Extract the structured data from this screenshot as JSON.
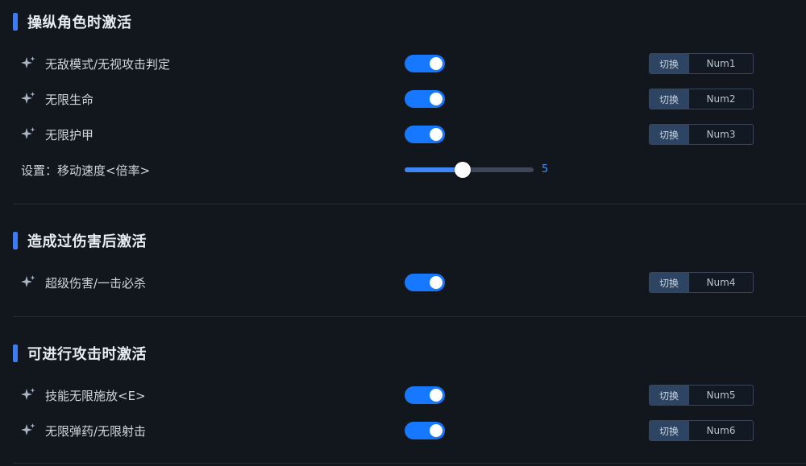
{
  "sections": [
    {
      "title": "操纵角色时激活",
      "items": [
        {
          "label": "无敌模式/无视攻击判定",
          "enabled": true,
          "hotkey_button": "切换",
          "hotkey": "Num1",
          "icon": "sparkle-icon"
        },
        {
          "label": "无限生命",
          "enabled": true,
          "hotkey_button": "切换",
          "hotkey": "Num2",
          "icon": "sparkle-icon"
        },
        {
          "label": "无限护甲",
          "enabled": true,
          "hotkey_button": "切换",
          "hotkey": "Num3",
          "icon": "sparkle-icon"
        }
      ],
      "setting": {
        "label": "设置：移动速度<倍率>",
        "value": "5",
        "min": 0,
        "max": 10,
        "level": 0.45
      }
    },
    {
      "title": "造成过伤害后激活",
      "items": [
        {
          "label": "超级伤害/一击必杀",
          "enabled": true,
          "hotkey_button": "切换",
          "hotkey": "Num4",
          "icon": "sparkle-icon"
        }
      ]
    },
    {
      "title": "可进行攻击时激活",
      "items": [
        {
          "label": "技能无限施放<E>",
          "enabled": true,
          "hotkey_button": "切换",
          "hotkey": "Num5",
          "icon": "sparkle-icon"
        },
        {
          "label": "无限弹药/无限射击",
          "enabled": true,
          "hotkey_button": "切换",
          "hotkey": "Num6",
          "icon": "sparkle-icon"
        }
      ]
    }
  ],
  "colors": {
    "accent": "#3d7bf2",
    "toggle_on": "#1677ff",
    "background": "#12161d",
    "slider_value": "#4d8cf0"
  }
}
